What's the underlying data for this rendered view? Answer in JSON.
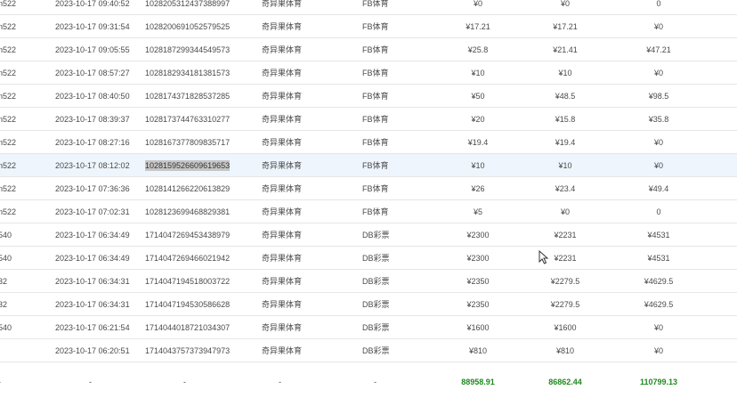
{
  "table": {
    "rows": [
      {
        "account": "n522",
        "time": "2023-10-17 09:40:52",
        "order_id": "1028205312437388997",
        "category": "奇异果体育",
        "platform": "FB体育",
        "bet": "¥0",
        "valid": "¥0",
        "win": "0"
      },
      {
        "account": "n522",
        "time": "2023-10-17 09:31:54",
        "order_id": "1028200691052579525",
        "category": "奇异果体育",
        "platform": "FB体育",
        "bet": "¥17.21",
        "valid": "¥17.21",
        "win": "¥0"
      },
      {
        "account": "n522",
        "time": "2023-10-17 09:05:55",
        "order_id": "1028187299344549573",
        "category": "奇异果体育",
        "platform": "FB体育",
        "bet": "¥25.8",
        "valid": "¥21.41",
        "win": "¥47.21"
      },
      {
        "account": "n522",
        "time": "2023-10-17 08:57:27",
        "order_id": "1028182934181381573",
        "category": "奇异果体育",
        "platform": "FB体育",
        "bet": "¥10",
        "valid": "¥10",
        "win": "¥0"
      },
      {
        "account": "n522",
        "time": "2023-10-17 08:40:50",
        "order_id": "1028174371828537285",
        "category": "奇异果体育",
        "platform": "FB体育",
        "bet": "¥50",
        "valid": "¥48.5",
        "win": "¥98.5"
      },
      {
        "account": "n522",
        "time": "2023-10-17 08:39:37",
        "order_id": "1028173744763310277",
        "category": "奇异果体育",
        "platform": "FB体育",
        "bet": "¥20",
        "valid": "¥15.8",
        "win": "¥35.8"
      },
      {
        "account": "n522",
        "time": "2023-10-17 08:27:16",
        "order_id": "1028167377809835717",
        "category": "奇异果体育",
        "platform": "FB体育",
        "bet": "¥19.4",
        "valid": "¥19.4",
        "win": "¥0"
      },
      {
        "account": "n522",
        "time": "2023-10-17 08:12:02",
        "order_id": "1028159526609619653",
        "category": "奇异果体育",
        "platform": "FB体育",
        "bet": "¥10",
        "valid": "¥10",
        "win": "¥0"
      },
      {
        "account": "n522",
        "time": "2023-10-17 07:36:36",
        "order_id": "1028141266220613829",
        "category": "奇异果体育",
        "platform": "FB体育",
        "bet": "¥26",
        "valid": "¥23.4",
        "win": "¥49.4"
      },
      {
        "account": "n522",
        "time": "2023-10-17 07:02:31",
        "order_id": "1028123699468829381",
        "category": "奇异果体育",
        "platform": "FB体育",
        "bet": "¥5",
        "valid": "¥0",
        "win": "0"
      },
      {
        "account": "540",
        "time": "2023-10-17 06:34:49",
        "order_id": "1714047269453438979",
        "category": "奇异果体育",
        "platform": "DB彩票",
        "bet": "¥2300",
        "valid": "¥2231",
        "win": "¥4531"
      },
      {
        "account": "540",
        "time": "2023-10-17 06:34:49",
        "order_id": "1714047269466021942",
        "category": "奇异果体育",
        "platform": "DB彩票",
        "bet": "¥2300",
        "valid": "¥2231",
        "win": "¥4531"
      },
      {
        "account": "32",
        "time": "2023-10-17 06:34:31",
        "order_id": "1714047194518003722",
        "category": "奇异果体育",
        "platform": "DB彩票",
        "bet": "¥2350",
        "valid": "¥2279.5",
        "win": "¥4629.5"
      },
      {
        "account": "32",
        "time": "2023-10-17 06:34:31",
        "order_id": "1714047194530586628",
        "category": "奇异果体育",
        "platform": "DB彩票",
        "bet": "¥2350",
        "valid": "¥2279.5",
        "win": "¥4629.5"
      },
      {
        "account": "540",
        "time": "2023-10-17 06:21:54",
        "order_id": "1714044018721034307",
        "category": "奇异果体育",
        "platform": "DB彩票",
        "bet": "¥1600",
        "valid": "¥1600",
        "win": "¥0"
      },
      {
        "account": "",
        "time": "2023-10-17 06:20:51",
        "order_id": "1714043757373947973",
        "category": "奇异果体育",
        "platform": "DB彩票",
        "bet": "¥810",
        "valid": "¥810",
        "win": "¥0"
      }
    ],
    "highlighted_row": 7,
    "selected_cell": "order_id"
  },
  "totals": {
    "account": "-",
    "time": "-",
    "order_id": "-",
    "category": "-",
    "platform": "-",
    "bet": "88958.91",
    "valid": "86862.44",
    "win": "110799.13"
  },
  "colors": {
    "row_border": "#e6e6e6",
    "highlight_bg": "#eef5fd",
    "selection_bg": "#c6c6c6",
    "total_green": "#1f8a1f"
  },
  "icons": {
    "cursor": "mouse-pointer-icon"
  }
}
